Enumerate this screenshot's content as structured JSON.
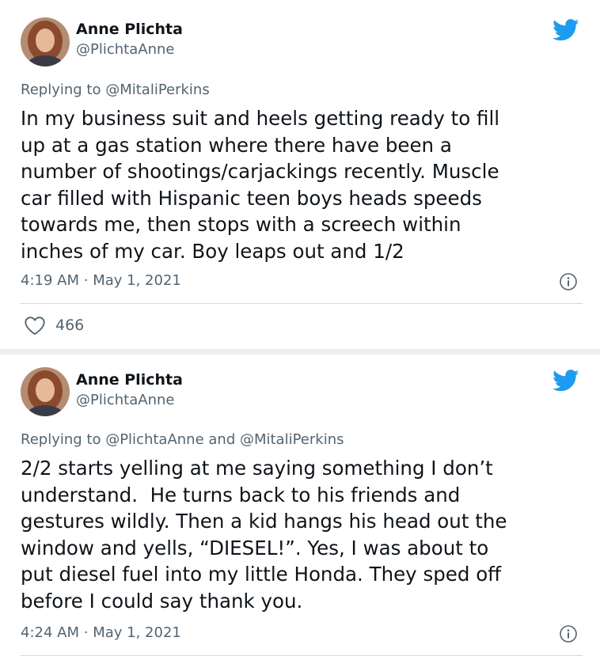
{
  "tweets": [
    {
      "author_name": "Anne Plichta",
      "author_handle": "@PlichtaAnne",
      "replying_to_prefix": "Replying to ",
      "replying_to": "@MitaliPerkins",
      "text": "In my business suit and heels getting ready to fill\nup at a gas station where there have been a\nnumber of shootings/carjackings recently. Muscle\ncar filled with Hispanic teen boys heads speeds\ntowards me, then stops with a screech within\ninches of my car. Boy leaps out and 1/2",
      "time": "4:19 AM",
      "separator": "·",
      "date": "May 1, 2021",
      "likes": "466",
      "icons": {
        "bird": "twitter-bird-icon",
        "info": "info-icon",
        "heart": "heart-icon"
      }
    },
    {
      "author_name": "Anne Plichta",
      "author_handle": "@PlichtaAnne",
      "replying_to_prefix": "Replying to ",
      "replying_to": "@PlichtaAnne and @MitaliPerkins",
      "text": "2/2 starts yelling at me saying something I don’t\nunderstand.  He turns back to his friends and\ngestures wildly. Then a kid hangs his head out the\nwindow and yells, “DIESEL!”. Yes, I was about to\nput diesel fuel into my little Honda. They sped off\nbefore I could say thank you.",
      "time": "4:24 AM",
      "separator": "·",
      "date": "May 1, 2021",
      "icons": {
        "bird": "twitter-bird-icon",
        "info": "info-icon"
      }
    }
  ],
  "colors": {
    "twitter_blue": "#1d9bf0",
    "text_primary": "#0f1419",
    "text_secondary": "#536471",
    "divider": "#cfd9de",
    "gap_background": "#ebeef0"
  }
}
